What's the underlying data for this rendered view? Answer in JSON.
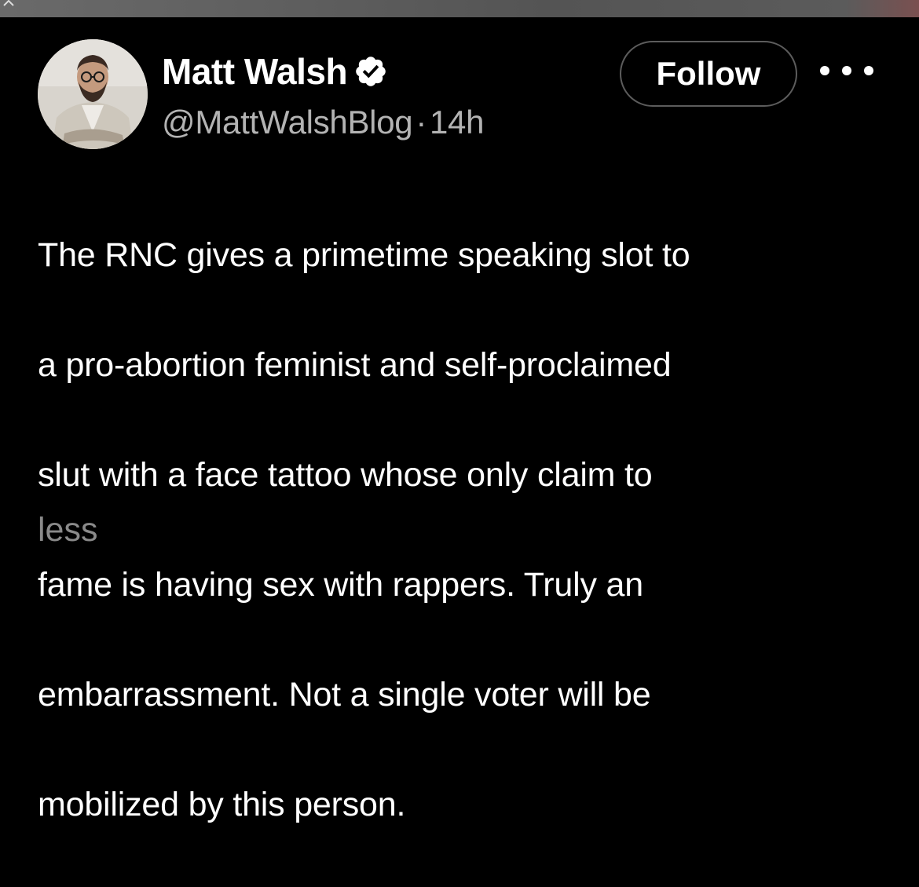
{
  "author": {
    "display_name": "Matt Walsh",
    "handle": "@MattWalshBlog",
    "separator": "·",
    "time": "14h",
    "verified_icon": "verified-badge-icon"
  },
  "actions": {
    "follow_label": "Follow",
    "more_icon": "more-horizontal-icon"
  },
  "tweet": {
    "text_lines": [
      "The RNC gives a primetime speaking slot to",
      "a pro-abortion feminist and self-proclaimed",
      "slut with a face tattoo whose only claim to",
      "fame is having sex with rappers. Truly an",
      "embarrassment. Not a single voter will be",
      "mobilized by this person."
    ],
    "less_label": "less"
  },
  "colors": {
    "background": "#000000",
    "text": "#ffffff",
    "secondary_text": "#b3b3b3",
    "less_link": "#8a8a8a",
    "follow_border": "#5c5c5c"
  }
}
